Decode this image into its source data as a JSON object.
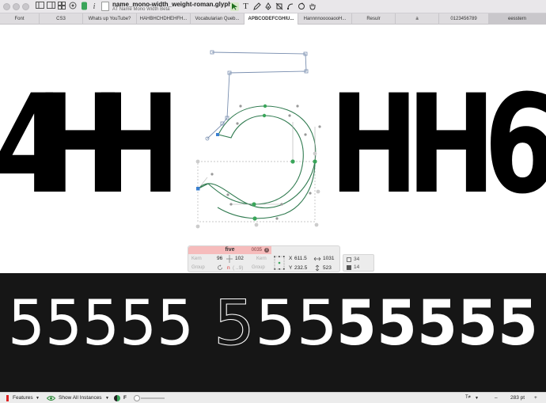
{
  "window": {
    "document_title": "name_mono-width_weight-roman.glyphs",
    "document_subtitle": "AT Name Mono Width Beta"
  },
  "toolbar": {
    "icons": [
      "sidebar-icon",
      "panel-icon",
      "grid-icon",
      "paint-icon",
      "layers-icon",
      "italic-icon"
    ],
    "tools": [
      "select-tool",
      "text-tool",
      "draw-tool",
      "pen-tool",
      "rectangle-tool",
      "oval-tool",
      "rotate-tool",
      "hand-tool"
    ]
  },
  "tabs": [
    "Font",
    "CS3",
    "Whats up YouTube?",
    "HAHBHCHDHEHFH...",
    "Vocabularian Queb...",
    "APBCODEFCGHIU...",
    "HannnnooooaooH...",
    "Resulr",
    "a",
    "0123456789",
    "eesstern"
  ],
  "active_tab_index": 5,
  "canvas": {
    "left_text": "4HH",
    "right_text": "HH6"
  },
  "info": {
    "glyph_name": "five",
    "unicode": "0035",
    "kern_label": "Kern",
    "group_label": "Group",
    "left_sidebearing": "96",
    "right_sidebearing": "102",
    "width_label": "n",
    "width_hint": "( ..9)",
    "x_label": "X",
    "x_value": "611.5",
    "y_label": "Y",
    "y_value": "232.5",
    "w_value": "1031",
    "h_value": "523",
    "count_a": "34",
    "count_b": "14"
  },
  "preview": {
    "digits": "5555555555555"
  },
  "bottombar": {
    "features_label": "Features",
    "instances_label": "Show All Instances",
    "font_glyph": "F",
    "zoom_value": "283 pt"
  },
  "colors": {
    "node_green": "#3aa55a",
    "node_blue": "#3a7fd0",
    "outline_active": "#2f7a4f",
    "outline_back": "#7a8fb0",
    "preview_bg": "#161616",
    "info_name_bg": "#f6bcbc"
  }
}
